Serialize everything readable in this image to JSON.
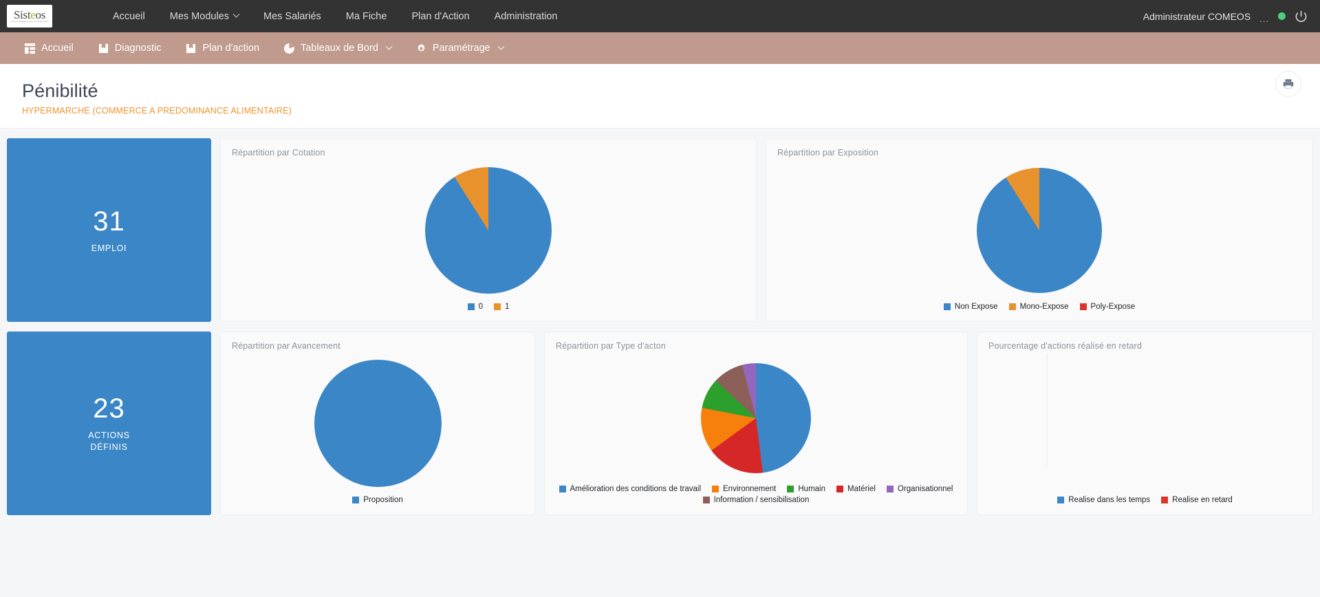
{
  "topnav": {
    "logo": {
      "name": "Sisteos",
      "part1": "Sist",
      "leaf": "e",
      "part2": "os",
      "tagline": "solutions et services pour la santé et la sécurité au travail"
    },
    "items": [
      {
        "label": "Accueil",
        "has_caret": false
      },
      {
        "label": "Mes Modules",
        "has_caret": true
      },
      {
        "label": "Mes Salariés",
        "has_caret": false
      },
      {
        "label": "Ma Fiche",
        "has_caret": false
      },
      {
        "label": "Plan d'Action",
        "has_caret": false
      },
      {
        "label": "Administration",
        "has_caret": false
      }
    ],
    "user": "Administrateur COMEOS",
    "user_dots": "...",
    "status": "online",
    "power_label": "power-off"
  },
  "subnav": {
    "items": [
      {
        "label": "Accueil",
        "icon": "dashboard-icon",
        "has_caret": false
      },
      {
        "label": "Diagnostic",
        "icon": "book-icon",
        "has_caret": false
      },
      {
        "label": "Plan d'action",
        "icon": "book-icon",
        "has_caret": false
      },
      {
        "label": "Tableaux de Bord",
        "icon": "pie-chart-icon",
        "has_caret": true
      },
      {
        "label": "Paramétrage",
        "icon": "gear-icon",
        "has_caret": true
      }
    ]
  },
  "header": {
    "title": "Pénibilité",
    "subtitle": "HYPERMARCHE (COMMERCE A PREDOMINANCE ALIMENTAIRE)",
    "print_icon": "print-icon"
  },
  "kpis": [
    {
      "value": "31",
      "label": "EMPLOI"
    },
    {
      "value": "23",
      "label_line1": "ACTIONS",
      "label_line2": "DÉFINIS"
    }
  ],
  "colors": {
    "accent_blue": "#3b86c7",
    "orange": "#e8922e",
    "red": "#d9372d",
    "green": "#2ca02c",
    "purple": "#9467bd",
    "brown": "#8c6058",
    "subnav_bg": "#c09a8c",
    "topnav_bg": "#333333",
    "subtitle_orange": "#f0932b",
    "status_green": "#4cd07d"
  },
  "chart_data": [
    {
      "id": "cotation",
      "type": "pie",
      "title": "Répartition par Cotation",
      "labels": [
        "0",
        "1"
      ],
      "values": [
        91,
        9
      ],
      "colors": [
        "#3b86c7",
        "#e8922e"
      ],
      "legend_position": "bottom"
    },
    {
      "id": "exposition",
      "type": "pie",
      "title": "Répartition par Exposition",
      "labels": [
        "Non Expose",
        "Mono-Expose",
        "Poly-Expose"
      ],
      "values": [
        91,
        9,
        0
      ],
      "colors": [
        "#3b86c7",
        "#e8922e",
        "#d9372d"
      ],
      "legend_position": "bottom"
    },
    {
      "id": "avancement",
      "type": "pie",
      "title": "Répartition par Avancement",
      "labels": [
        "Proposition"
      ],
      "values": [
        100
      ],
      "colors": [
        "#3b86c7"
      ],
      "legend_position": "bottom"
    },
    {
      "id": "type-action",
      "type": "pie",
      "title": "Répartition par Type d'acton",
      "labels": [
        "Amélioration des conditions de travail",
        "Environnement",
        "Humain",
        "Matériel",
        "Organisationnel",
        "Information / sensibilisation"
      ],
      "values": [
        48,
        13,
        9,
        17,
        4,
        9
      ],
      "colors": [
        "#3b86c7",
        "#f77f0c",
        "#2ca02c",
        "#d62728",
        "#9467bd",
        "#8c6058"
      ],
      "legend_position": "bottom"
    },
    {
      "id": "retard",
      "type": "pie",
      "title": "Pourcentage d'actions réalisé en retard",
      "labels": [
        "Realise dans les temps",
        "Realise en retard"
      ],
      "values": [
        0,
        0
      ],
      "colors": [
        "#3b86c7",
        "#d9372d"
      ],
      "legend_position": "bottom",
      "empty": true
    }
  ]
}
